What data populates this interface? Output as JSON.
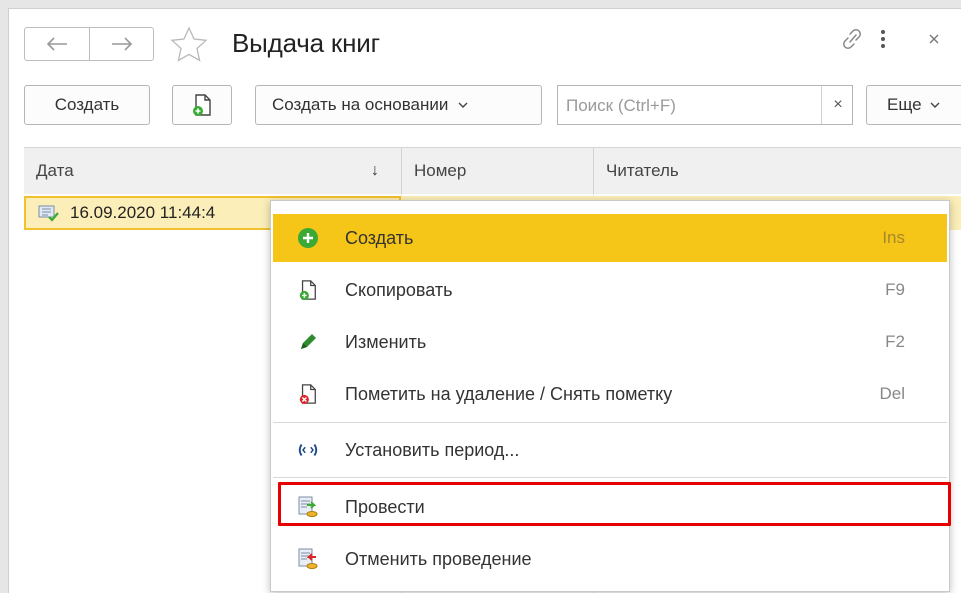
{
  "window": {
    "title": "Выдача книг"
  },
  "toolbar": {
    "create_label": "Создать",
    "create_based_label": "Создать на основании",
    "more_label": "Еще",
    "search_placeholder": "Поиск (Ctrl+F)",
    "clear_symbol": "×"
  },
  "table": {
    "columns": [
      "Дата",
      "Номер",
      "Читатель"
    ],
    "sort_indicator": "↓",
    "rows": [
      {
        "date": "16.09.2020 11:44:4"
      }
    ]
  },
  "context_menu": {
    "items": [
      {
        "label": "Создать",
        "shortcut": "Ins",
        "icon": "plus-circle-icon",
        "highlighted": true
      },
      {
        "label": "Скопировать",
        "shortcut": "F9",
        "icon": "copy-document-icon"
      },
      {
        "label": "Изменить",
        "shortcut": "F2",
        "icon": "pencil-icon"
      },
      {
        "label": "Пометить на удаление / Снять пометку",
        "shortcut": "Del",
        "icon": "delete-mark-icon"
      },
      {
        "label": "Установить период...",
        "shortcut": "",
        "icon": "period-icon"
      },
      {
        "label": "Провести",
        "shortcut": "",
        "icon": "post-document-icon",
        "outlined": true
      },
      {
        "label": "Отменить проведение",
        "shortcut": "",
        "icon": "unpost-document-icon"
      }
    ]
  },
  "colors": {
    "highlight": "#f5c518",
    "selected_row": "#fbeeb8",
    "outline": "#e60000",
    "accent_green": "#3aaa35"
  }
}
